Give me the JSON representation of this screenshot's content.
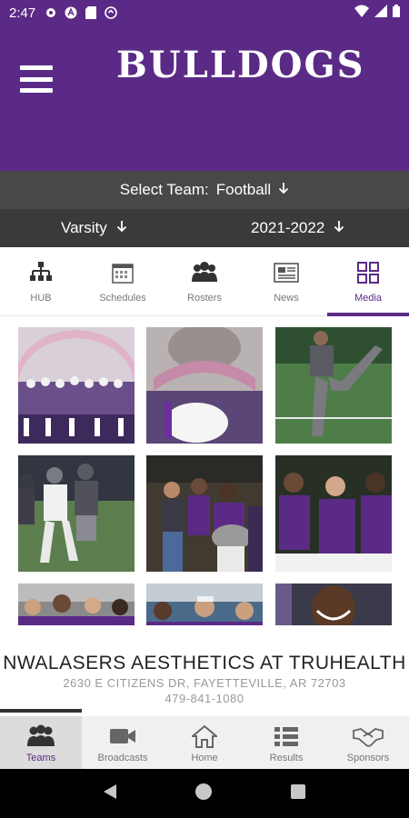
{
  "status_bar": {
    "time": "2:47"
  },
  "header": {
    "title": "BULLDOGS"
  },
  "team_select": {
    "label": "Select Team:",
    "value": "Football"
  },
  "filters": {
    "level": "Varsity",
    "season": "2021-2022"
  },
  "tabs": [
    {
      "label": "HUB",
      "icon": "hierarchy-icon"
    },
    {
      "label": "Schedules",
      "icon": "calendar-icon"
    },
    {
      "label": "Rosters",
      "icon": "group-icon"
    },
    {
      "label": "News",
      "icon": "newspaper-icon"
    },
    {
      "label": "Media",
      "icon": "grid-icon",
      "active": true
    }
  ],
  "sponsor": {
    "name": "NWALASERS AESTHETICS AT TRUHEALTH",
    "address": "2630 E CITIZENS DR, FAYETTEVILLE, AR 72703",
    "phone": "479-841-1080"
  },
  "bottom_nav": [
    {
      "label": "Teams",
      "icon": "teams-icon",
      "active": true
    },
    {
      "label": "Broadcasts",
      "icon": "video-icon"
    },
    {
      "label": "Home",
      "icon": "home-icon"
    },
    {
      "label": "Results",
      "icon": "list-icon"
    },
    {
      "label": "Sponsors",
      "icon": "handshake-icon"
    }
  ],
  "colors": {
    "brand": "#5b2a86",
    "team_select_bg": "#484848",
    "filters_bg": "#3a3a3a"
  }
}
